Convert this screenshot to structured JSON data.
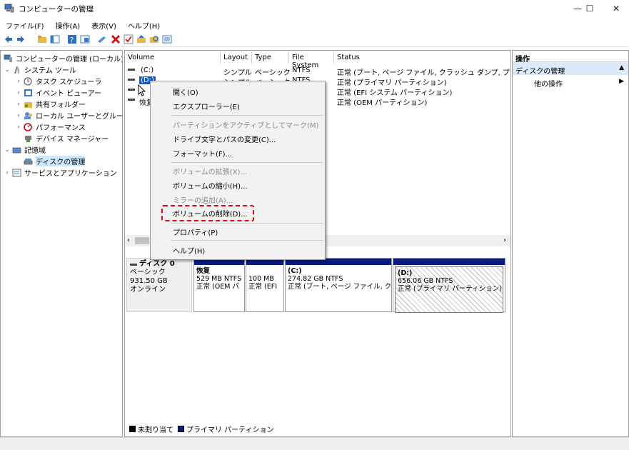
{
  "window": {
    "title": "コンピューターの管理",
    "minimize": "—",
    "maximize": "☐",
    "close": "✕"
  },
  "menu": [
    "ファイル(F)",
    "操作(A)",
    "表示(V)",
    "ヘルプ(H)"
  ],
  "tree": {
    "root": "コンピューターの管理 (ローカル)",
    "system_tools": "システム ツール",
    "task_scheduler": "タスク スケジューラ",
    "event_viewer": "イベント ビューアー",
    "shared_folders": "共有フォルダー",
    "local_users": "ローカル ユーザーとグループ",
    "performance": "パフォーマンス",
    "device_manager": "デバイス マネージャー",
    "storage": "記憶域",
    "disk_management": "ディスクの管理",
    "services_apps": "サービスとアプリケーション"
  },
  "volumes": {
    "headers": [
      "Volume",
      "Layout",
      "Type",
      "File System",
      "Status"
    ],
    "rows": [
      {
        "volume": "(C:)",
        "layout": "シンプル",
        "type": "ベーシック",
        "fs": "NTFS",
        "status": "正常 (ブート, ページ ファイル, クラッシュ ダンプ, プライマリ /"
      },
      {
        "volume": "(D:)",
        "layout": "シンプル",
        "type": "ベーシック",
        "fs": "NTFS",
        "status": "正常 (プライマリ パーティション)"
      },
      {
        "volume": "",
        "layout": "",
        "type": "",
        "fs": "",
        "status": "正常 (EFI システム パーティション)"
      },
      {
        "volume": "恢复",
        "layout": "",
        "type": "",
        "fs": "",
        "status": "正常 (OEM パーティション)"
      }
    ]
  },
  "disk": {
    "name": "ディスク 0",
    "type": "ベーシック",
    "size": "931.50 GB",
    "state": "オンライン"
  },
  "partitions": [
    {
      "name": "恢复",
      "size": "529 MB NTFS",
      "status": "正常 (OEM パ"
    },
    {
      "name": "",
      "size": "100 MB",
      "status": "正常 (EFI"
    },
    {
      "name": "(C:)",
      "size": "274.82 GB NTFS",
      "status": "正常 (ブート, ページ ファイル, クラ"
    },
    {
      "name": "(D:)",
      "size": "656.06 GB NTFS",
      "status": "正常 (プライマリ パーティション)"
    }
  ],
  "legend": {
    "unallocated": "未割り当て",
    "primary": "プライマリ パーティション"
  },
  "actions": {
    "header": "操作",
    "section": "ディスクの管理",
    "other": "他の操作"
  },
  "context_menu": {
    "open": "開く(O)",
    "explore": "エクスプローラー(E)",
    "mark_active": "パーティションをアクティブとしてマーク(M)",
    "change_letter": "ドライブ文字とパスの変更(C)...",
    "format": "フォーマット(F)...",
    "extend": "ボリュームの拡張(X)...",
    "shrink": "ボリュームの縮小(H)...",
    "add_mirror": "ミラーの追加(A)...",
    "delete": "ボリュームの削除(D)...",
    "properties": "プロパティ(P)",
    "help": "ヘルプ(H)"
  },
  "colors": {
    "primary_partition": "#0a1b7e",
    "highlight": "#e60012",
    "selection": "#cce8ff"
  }
}
